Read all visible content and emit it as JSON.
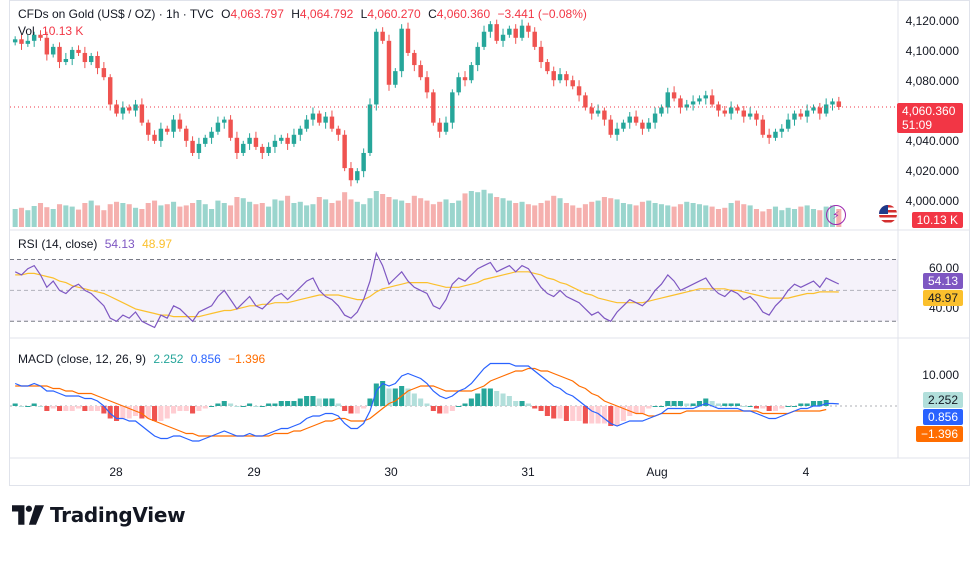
{
  "header": {
    "symbol": "CFDs on Gold (US$ / OZ) · 1h · TVC",
    "open_label": "O",
    "open": "4,063.797",
    "high_label": "H",
    "high": "4,064.792",
    "low_label": "L",
    "low": "4,060.270",
    "close_label": "C",
    "close": "4,060.360",
    "change": "−3.441 (−0.08%)"
  },
  "volume_legend": {
    "label": "Vol",
    "value": "10.13 K"
  },
  "rsi_legend": {
    "label": "RSI (14, close)",
    "value": "54.13",
    "ma_value": "48.97"
  },
  "macd_legend": {
    "label": "MACD (close, 12, 26, 9)",
    "hist": "2.252",
    "macd": "0.856",
    "signal": "−1.396"
  },
  "price_axis": [
    "4,120.000",
    "4,100.000",
    "4,080.000",
    "4,040.000",
    "4,020.000",
    "4,000.000"
  ],
  "rsi_axis": [
    "60.00",
    "40.00"
  ],
  "macd_axis": [
    "10.000"
  ],
  "tags": {
    "price": "4,060.360",
    "countdown": "51:09",
    "volume": "10.13 K",
    "rsi": "54.13",
    "rsi_ma": "48.97",
    "hist": "2.252",
    "macd": "0.856",
    "signal": "−1.396"
  },
  "time_axis": [
    "28",
    "29",
    "30",
    "31",
    "Aug",
    "4"
  ],
  "brand": "TradingView",
  "colors": {
    "up": "#26a69a",
    "down": "#ef5350",
    "rsi": "#7e57c2",
    "rsi_ma": "#fbc02d",
    "macd": "#2962ff",
    "signal": "#ff6d00",
    "price_tag": "#f23645"
  },
  "chart_data": {
    "type": "candlestick",
    "price_range": [
      3995,
      4125
    ],
    "closes": [
      4105,
      4102,
      4104,
      4108,
      4106,
      4095,
      4100,
      4090,
      4092,
      4098,
      4096,
      4090,
      4094,
      4086,
      4080,
      4062,
      4056,
      4060,
      4058,
      4062,
      4050,
      4042,
      4038,
      4046,
      4044,
      4052,
      4046,
      4038,
      4030,
      4036,
      4040,
      4044,
      4050,
      4052,
      4040,
      4030,
      4036,
      4040,
      4034,
      4030,
      4034,
      4038,
      4040,
      4036,
      4042,
      4046,
      4052,
      4056,
      4050,
      4054,
      4046,
      4042,
      4020,
      4012,
      4018,
      4030,
      4062,
      4110,
      4104,
      4075,
      4084,
      4112,
      4096,
      4088,
      4080,
      4070,
      4050,
      4044,
      4050,
      4070,
      4080,
      4078,
      4088,
      4100,
      4110,
      4115,
      4104,
      4108,
      4112,
      4106,
      4114,
      4110,
      4100,
      4090,
      4084,
      4078,
      4082,
      4078,
      4074,
      4068,
      4060,
      4056,
      4058,
      4052,
      4042,
      4046,
      4050,
      4054,
      4050,
      4046,
      4050,
      4056,
      4060,
      4070,
      4066,
      4060,
      4062,
      4064,
      4066,
      4068,
      4062,
      4058,
      4056,
      4060,
      4058,
      4054,
      4056,
      4052,
      4042,
      4040,
      4044,
      4046,
      4052,
      4056,
      4054,
      4058,
      4060,
      4056,
      4062,
      4064,
      4060.36
    ],
    "volume": [
      30,
      32,
      28,
      35,
      40,
      33,
      30,
      38,
      36,
      34,
      29,
      40,
      44,
      36,
      28,
      38,
      42,
      40,
      38,
      32,
      30,
      40,
      44,
      36,
      38,
      42,
      34,
      36,
      40,
      45,
      38,
      30,
      44,
      40,
      36,
      50,
      48,
      42,
      38,
      40,
      34,
      46,
      44,
      52,
      40,
      42,
      36,
      38,
      50,
      46,
      40,
      44,
      58,
      46,
      42,
      38,
      48,
      60,
      55,
      50,
      46,
      44,
      40,
      52,
      48,
      44,
      38,
      42,
      46,
      40,
      44,
      56,
      60,
      58,
      62,
      56,
      50,
      48,
      44,
      40,
      42,
      38,
      36,
      40,
      44,
      52,
      48,
      40,
      36,
      32,
      38,
      42,
      44,
      50,
      48,
      46,
      40,
      38,
      36,
      42,
      44,
      40,
      38,
      36,
      34,
      38,
      42,
      40,
      38,
      36,
      34,
      30,
      32,
      40,
      44,
      38,
      36,
      30,
      26,
      30,
      34,
      28,
      32,
      30,
      34,
      36,
      30,
      28,
      34,
      36,
      30
    ],
    "rsi": [
      62,
      60,
      64,
      66,
      60,
      52,
      56,
      50,
      48,
      52,
      54,
      50,
      48,
      44,
      40,
      32,
      30,
      34,
      32,
      36,
      30,
      28,
      26,
      34,
      32,
      40,
      38,
      34,
      30,
      36,
      38,
      40,
      46,
      50,
      44,
      38,
      42,
      46,
      40,
      38,
      42,
      46,
      48,
      44,
      48,
      52,
      56,
      58,
      50,
      46,
      44,
      40,
      34,
      32,
      36,
      44,
      56,
      74,
      66,
      54,
      58,
      62,
      56,
      52,
      50,
      48,
      40,
      38,
      44,
      54,
      58,
      56,
      60,
      64,
      66,
      68,
      62,
      64,
      66,
      62,
      66,
      64,
      58,
      52,
      48,
      46,
      50,
      46,
      44,
      42,
      38,
      34,
      36,
      32,
      30,
      36,
      40,
      44,
      42,
      40,
      44,
      50,
      54,
      60,
      56,
      50,
      52,
      54,
      56,
      58,
      52,
      48,
      46,
      50,
      48,
      44,
      46,
      42,
      36,
      34,
      40,
      44,
      50,
      54,
      52,
      54,
      56,
      52,
      58,
      56,
      54.13
    ],
    "rsi_ma": [
      60,
      60,
      61,
      61,
      60,
      59,
      58,
      56,
      55,
      53,
      52,
      51,
      50,
      49,
      48,
      46,
      44,
      42,
      40,
      38,
      37,
      36,
      35,
      34,
      34,
      33,
      33,
      33,
      33,
      33,
      34,
      35,
      36,
      37,
      37,
      38,
      39,
      40,
      40,
      41,
      41,
      42,
      42,
      42,
      43,
      44,
      45,
      46,
      47,
      47,
      47,
      47,
      46,
      45,
      44,
      44,
      46,
      49,
      51,
      52,
      53,
      54,
      55,
      55,
      55,
      55,
      54,
      53,
      52,
      52,
      52,
      53,
      54,
      55,
      57,
      58,
      59,
      60,
      61,
      62,
      62,
      62,
      61,
      60,
      58,
      57,
      55,
      54,
      52,
      50,
      48,
      47,
      45,
      44,
      43,
      42,
      42,
      42,
      42,
      42,
      43,
      44,
      45,
      46,
      47,
      48,
      49,
      50,
      51,
      51,
      51,
      51,
      51,
      50,
      50,
      49,
      48,
      47,
      46,
      45,
      45,
      45,
      45,
      46,
      47,
      48,
      48,
      49,
      49,
      49,
      48.97
    ],
    "macd": [
      9,
      8,
      8,
      9,
      8,
      6,
      6,
      5,
      4,
      4,
      4,
      3,
      3,
      2,
      0,
      -3,
      -5,
      -5,
      -6,
      -6,
      -8,
      -10,
      -12,
      -13,
      -13,
      -12,
      -12,
      -13,
      -14,
      -14,
      -13,
      -12,
      -11,
      -10,
      -11,
      -12,
      -12,
      -11,
      -12,
      -12,
      -11,
      -10,
      -9,
      -9,
      -8,
      -7,
      -5,
      -4,
      -4,
      -3,
      -3,
      -4,
      -7,
      -9,
      -9,
      -7,
      -2,
      6,
      9,
      8,
      9,
      12,
      13,
      12,
      11,
      9,
      6,
      4,
      3,
      4,
      6,
      7,
      9,
      12,
      15,
      17,
      17,
      17,
      17,
      16,
      16,
      16,
      14,
      12,
      10,
      8,
      7,
      5,
      4,
      2,
      0,
      -2,
      -3,
      -5,
      -7,
      -8,
      -7,
      -6,
      -6,
      -6,
      -5,
      -4,
      -3,
      -1,
      -1,
      -1,
      -1,
      -1,
      0,
      1,
      0,
      -1,
      -1,
      -1,
      -1,
      -2,
      -2,
      -3,
      -4,
      -5,
      -5,
      -4,
      -3,
      -2,
      -1,
      -1,
      0,
      0,
      1,
      1,
      0.856
    ],
    "signal": [
      8,
      8,
      8,
      8,
      8,
      8,
      7,
      7,
      6,
      6,
      5,
      5,
      5,
      4,
      3,
      2,
      1,
      0,
      -1,
      -2,
      -3,
      -5,
      -6,
      -7,
      -8,
      -9,
      -10,
      -11,
      -11,
      -12,
      -12,
      -12,
      -12,
      -12,
      -12,
      -12,
      -12,
      -12,
      -12,
      -12,
      -12,
      -11,
      -11,
      -11,
      -10,
      -10,
      -9,
      -8,
      -7,
      -6,
      -6,
      -5,
      -5,
      -6,
      -6,
      -6,
      -5,
      -3,
      -1,
      1,
      2,
      4,
      6,
      7,
      8,
      8,
      8,
      7,
      6,
      6,
      6,
      6,
      6,
      7,
      8,
      10,
      11,
      12,
      13,
      14,
      14,
      15,
      15,
      14,
      14,
      13,
      12,
      11,
      10,
      8,
      7,
      5,
      4,
      2,
      1,
      0,
      -1,
      -2,
      -3,
      -3,
      -4,
      -4,
      -3,
      -3,
      -3,
      -3,
      -2,
      -2,
      -2,
      -2,
      -2,
      -2,
      -2,
      -2,
      -2,
      -2,
      -2,
      -2,
      -3,
      -3,
      -3,
      -3,
      -3,
      -2,
      -2,
      -2,
      -2,
      -2,
      -1.396
    ],
    "macd_range": [
      -20,
      20
    ],
    "rsi_range": [
      25,
      80
    ]
  }
}
